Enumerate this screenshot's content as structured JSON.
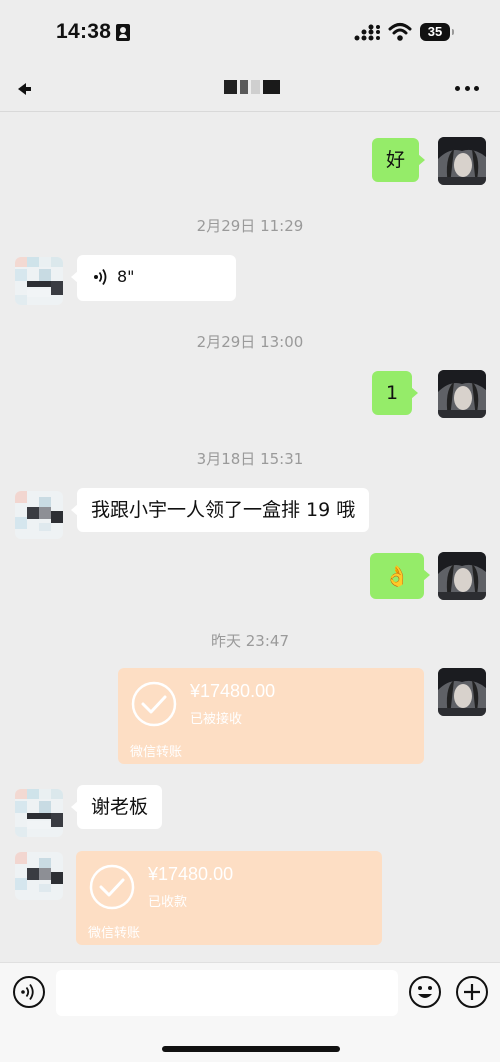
{
  "status_bar": {
    "time": "14:38",
    "battery": "35",
    "icons": [
      "person-card-icon",
      "signal-icon",
      "wifi-icon",
      "battery-icon"
    ]
  },
  "nav": {
    "back_icon": "back-arrow-icon",
    "more_icon": "more-icon",
    "title_pixel_colors": [
      "#222222",
      "#5a5a5a",
      "#cfcfcf",
      "#1a1a1a"
    ]
  },
  "chat": {
    "cutoff_timestamp": "2月29日 13:??",
    "messages": [
      {
        "type": "text",
        "side": "self",
        "text": "好"
      },
      {
        "type": "timestamp",
        "text": "2月29日 11:29"
      },
      {
        "type": "voice",
        "side": "other",
        "duration": "8\""
      },
      {
        "type": "timestamp",
        "text": "2月29日 13:00"
      },
      {
        "type": "text",
        "side": "self",
        "text": "1"
      },
      {
        "type": "timestamp",
        "text": "3月18日 15:31"
      },
      {
        "type": "text",
        "side": "other",
        "text": "我跟小宇一人领了一盒排 19 哦"
      },
      {
        "type": "emoji",
        "side": "self",
        "text": "👌"
      },
      {
        "type": "timestamp",
        "text": "昨天 23:47"
      },
      {
        "type": "transfer",
        "side": "self",
        "amount": "¥17480.00",
        "status": "已被接收",
        "footer": "微信转账"
      },
      {
        "type": "text",
        "side": "other",
        "text": "谢老板"
      },
      {
        "type": "transfer",
        "side": "other",
        "amount": "¥17480.00",
        "status": "已收款",
        "footer": "微信转账"
      }
    ]
  },
  "input_bar": {
    "placeholder": "",
    "icons": [
      "voice-toggle-icon",
      "emoji-icon",
      "plus-icon"
    ]
  },
  "colors": {
    "background": "#ededed",
    "self_bubble": "#95ec69",
    "other_bubble": "#ffffff",
    "transfer_card": "#fddec4",
    "timestamp": "#9a9a9a"
  }
}
